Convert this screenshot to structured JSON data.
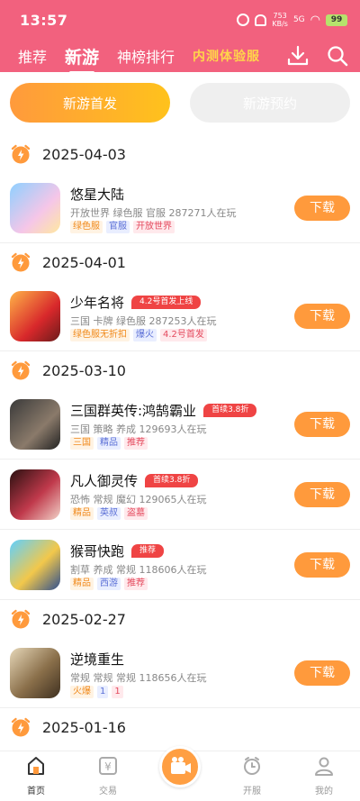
{
  "status_bar": {
    "time": "13:57",
    "net_speed": "753",
    "net_unit": "KB/s",
    "signal": "5G",
    "wifi": "WiFi",
    "battery": "99"
  },
  "nav": {
    "tabs": [
      {
        "label": "推荐"
      },
      {
        "label": "新游"
      },
      {
        "label": "神榜排行"
      },
      {
        "label": "内测体验服"
      }
    ],
    "active_tab": "新游",
    "download_icon": "download-icon",
    "search_icon": "search-icon"
  },
  "segments": {
    "on": "新游首发",
    "off": "新游预约"
  },
  "colors": {
    "header": "#f2617e",
    "accent": "#ff9a3c",
    "badge": "#ef4444"
  },
  "sections": [
    {
      "date": "2025-04-03",
      "games": [
        {
          "name": "悠星大陆",
          "badge": "",
          "meta": "开放世界  绿色服  官服  287271人在玩",
          "tags": [
            [
              "绿色服",
              "green"
            ],
            [
              "官服",
              "blue"
            ],
            [
              "开放世界",
              "red"
            ]
          ],
          "button": "下载"
        }
      ]
    },
    {
      "date": "2025-04-01",
      "games": [
        {
          "name": "少年名将",
          "badge": "4.2号首发上线",
          "meta": "三国  卡牌  绿色服  287253人在玩",
          "tags": [
            [
              "绿色服无折扣",
              "green"
            ],
            [
              "爆火",
              "blue"
            ],
            [
              "4.2号首发",
              "red"
            ]
          ],
          "button": "下载"
        }
      ]
    },
    {
      "date": "2025-03-10",
      "games": [
        {
          "name": "三国群英传:鸿鹄霸业",
          "badge": "首续3.8折",
          "meta": "三国  策略  养成  129693人在玩",
          "tags": [
            [
              "三国",
              "green"
            ],
            [
              "精品",
              "blue"
            ],
            [
              "推荐",
              "red"
            ]
          ],
          "button": "下载"
        },
        {
          "name": "凡人御灵传",
          "badge": "首续3.8折",
          "meta": "恐怖  常规  魔幻  129065人在玩",
          "tags": [
            [
              "精品",
              "green"
            ],
            [
              "英叔",
              "blue"
            ],
            [
              "盗墓",
              "red"
            ]
          ],
          "button": "下载"
        },
        {
          "name": "猴哥快跑",
          "badge": "推荐",
          "meta": "割草  养成  常规  118606人在玩",
          "tags": [
            [
              "精品",
              "green"
            ],
            [
              "西游",
              "blue"
            ],
            [
              "推荐",
              "red"
            ]
          ],
          "button": "下载"
        }
      ]
    },
    {
      "date": "2025-02-27",
      "games": [
        {
          "name": "逆境重生",
          "badge": "",
          "meta": "常规  常规  常规  118656人在玩",
          "tags": [
            [
              "火爆",
              "green"
            ],
            [
              "1",
              "blue"
            ],
            [
              "1",
              "red"
            ]
          ],
          "button": "下载"
        }
      ]
    },
    {
      "date": "2025-01-16",
      "games": []
    }
  ],
  "bottom_nav": {
    "items": [
      {
        "label": "首页"
      },
      {
        "label": "交易"
      },
      {
        "label": "开服"
      },
      {
        "label": "我的"
      }
    ]
  }
}
